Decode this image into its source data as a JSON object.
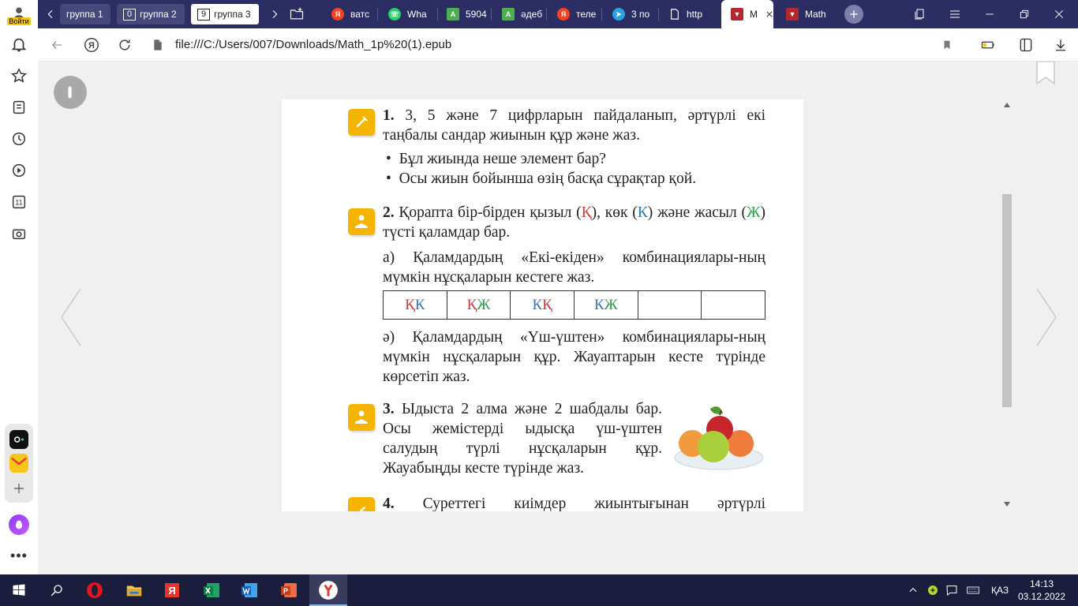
{
  "browser": {
    "groups": [
      {
        "label": "группа 1",
        "count": ""
      },
      {
        "label": "группа 2",
        "count": "0"
      },
      {
        "label": "группа 3",
        "count": "9"
      }
    ],
    "tabs": [
      {
        "label": "ватс",
        "icon": "yandex-icon",
        "color": "#fc3f1d"
      },
      {
        "label": "Wha",
        "icon": "whatsapp-icon",
        "color": "#25d366"
      },
      {
        "label": "5904",
        "icon": "a-icon",
        "color": "#4caf50"
      },
      {
        "label": "әдеб",
        "icon": "a-icon",
        "color": "#4caf50"
      },
      {
        "label": "теле",
        "icon": "yandex-icon",
        "color": "#fc3f1d"
      },
      {
        "label": "3 по",
        "icon": "telegram-icon",
        "color": "#2aa3e0"
      },
      {
        "label": "http",
        "icon": "page-icon",
        "color": "#ffffff"
      },
      {
        "label": "M",
        "icon": "book-icon",
        "color": "#b5262f",
        "active": true
      },
      {
        "label": "Math",
        "icon": "book-icon",
        "color": "#b5262f"
      }
    ],
    "address": "file:///C:/Users/007/Downloads/Math_1p%20(1).epub",
    "login_label": "Войти"
  },
  "document": {
    "task1": {
      "num": "1.",
      "text": "3, 5 және 7 цифрларын пайдаланып, әртүрлі екі таңбалы сандар жиынын құр және жаз.",
      "bullets": [
        "Бұл жиында неше элемент бар?",
        "Осы жиын бойынша өзің басқа сұрақтар қой."
      ]
    },
    "task2": {
      "num": "2.",
      "part1": "Қорапта бір-бірден қызыл (",
      "k_red": "Қ",
      "part2": "), көк (",
      "k_blue": "К",
      "part3": ") және жасыл (",
      "zh": "Ж",
      "part4": ") түсті қаламдар бар.",
      "a": "а) Қаламдардың «Екі-екіден» комбинациялары-ның мүмкін нұсқаларын кестеге жаз.",
      "combos": [
        [
          {
            "t": "Қ",
            "c": "#d23b3b"
          },
          {
            "t": "К",
            "c": "#3579b6"
          }
        ],
        [
          {
            "t": "Қ",
            "c": "#d23b3b"
          },
          {
            "t": "Ж",
            "c": "#2e9e4b"
          }
        ],
        [
          {
            "t": "К",
            "c": "#3579b6"
          },
          {
            "t": "Қ",
            "c": "#d23b3b"
          }
        ],
        [
          {
            "t": "К",
            "c": "#3579b6"
          },
          {
            "t": "Ж",
            "c": "#2e9e4b"
          }
        ],
        [],
        []
      ],
      "ae": "ә) Қаламдардың «Үш-үштен» комбинациялары-ның мүмкін нұсқаларын құр. Жауаптарын кесте түрінде көрсетіп жаз."
    },
    "task3": {
      "num": "3.",
      "text": "Ыдыста 2 алма және 2 шабдалы бар. Осы жемістерді ыдысқа үш-үштен салудың түрлі нұсқаларын құр. Жауабыңды кесте түрінде жаз."
    },
    "task4": {
      "num": "4.",
      "text": "Суреттегі киімдер жиынтығынан әртүрлі"
    }
  },
  "taskbar": {
    "lang": "ҚАЗ",
    "time": "14:13",
    "date": "03.12.2022"
  },
  "colors": {
    "tabbar": "#2c2e63",
    "taskbar": "#1b1d3c",
    "badge": "#f4b400"
  }
}
